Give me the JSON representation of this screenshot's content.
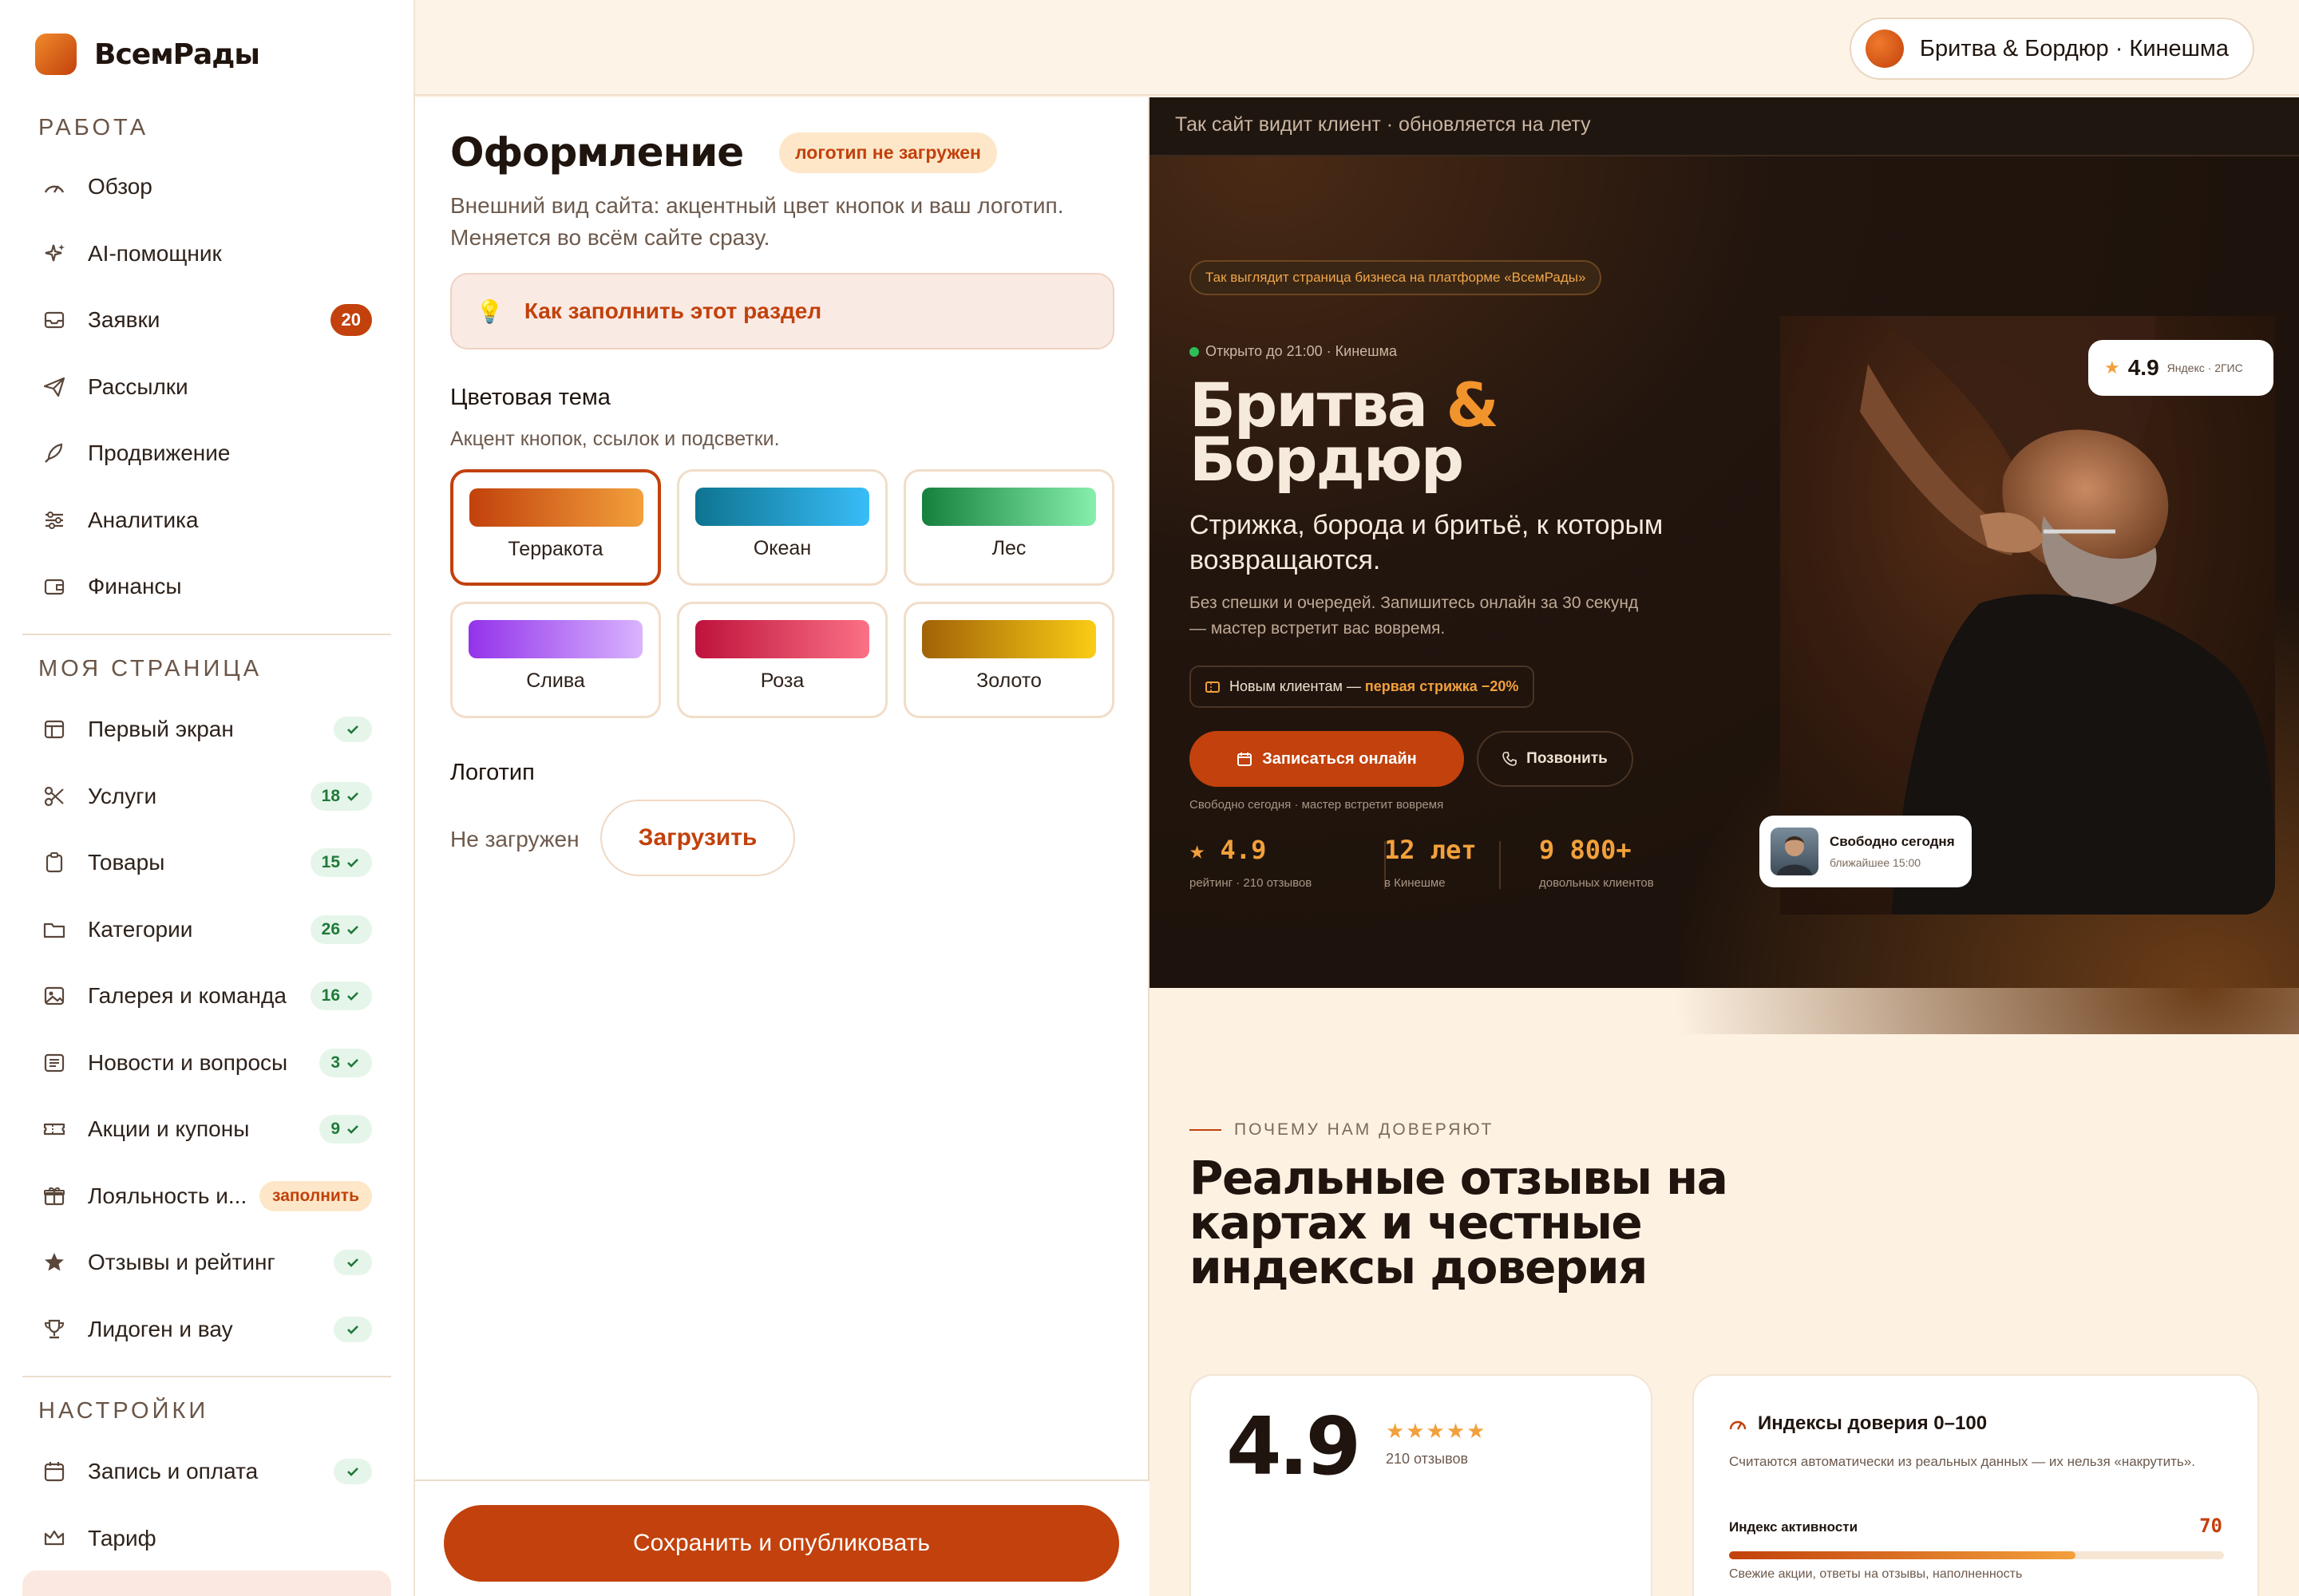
{
  "brand": {
    "name": "ВсемРады"
  },
  "business_pill": {
    "name": "Бритва & Бордюр · Кинешма"
  },
  "sidebar": {
    "section_work": "РАБОТА",
    "section_page": "МОЯ СТРАНИЦА",
    "section_settings": "НАСТРОЙКИ",
    "work_items": [
      {
        "label": "Обзор",
        "icon": "gauge-icon"
      },
      {
        "label": "AI-помощник",
        "icon": "sparkle-icon"
      },
      {
        "label": "Заявки",
        "icon": "inbox-icon",
        "badge": "20"
      },
      {
        "label": "Рассылки",
        "icon": "send-icon"
      },
      {
        "label": "Продвижение",
        "icon": "rocket-icon"
      },
      {
        "label": "Аналитика",
        "icon": "sliders-icon"
      },
      {
        "label": "Финансы",
        "icon": "wallet-icon"
      }
    ],
    "page_items": [
      {
        "label": "Первый экран",
        "icon": "layout-icon",
        "badge": ""
      },
      {
        "label": "Услуги",
        "icon": "scissors-icon",
        "badge": "18"
      },
      {
        "label": "Товары",
        "icon": "clipboard-icon",
        "badge": "15"
      },
      {
        "label": "Категории",
        "icon": "folder-icon",
        "badge": "26"
      },
      {
        "label": "Галерея и команда",
        "icon": "image-icon",
        "badge": "16"
      },
      {
        "label": "Новости и вопросы",
        "icon": "news-icon",
        "badge": "3"
      },
      {
        "label": "Акции и купоны",
        "icon": "ticket-icon",
        "badge": "9"
      },
      {
        "label": "Лояльность и...",
        "icon": "gift-icon",
        "badge_fill": "заполнить"
      },
      {
        "label": "Отзывы и рейтинг",
        "icon": "star-icon",
        "badge": ""
      },
      {
        "label": "Лидоген и вау",
        "icon": "trophy-icon",
        "badge": ""
      }
    ],
    "settings_items": [
      {
        "label": "Запись и оплата",
        "icon": "calendar-icon",
        "badge": ""
      },
      {
        "label": "Тариф",
        "icon": "crown-icon"
      }
    ]
  },
  "editor": {
    "title": "Оформление",
    "status": "логотип не загружен",
    "description": "Внешний вид сайта: акцентный цвет кнопок и ваш логотип. Меняется во всём сайте сразу.",
    "help": "Как заполнить этот раздел",
    "theme_label": "Цветовая тема",
    "theme_hint": "Акцент кнопок, ссылок и подсветки.",
    "themes": [
      {
        "name": "Терракота",
        "from": "#c2410c",
        "to": "#f2a03c",
        "selected": true
      },
      {
        "name": "Океан",
        "from": "#0e7490",
        "to": "#38bdf8",
        "selected": false
      },
      {
        "name": "Лес",
        "from": "#15803d",
        "to": "#86efac",
        "selected": false
      },
      {
        "name": "Слива",
        "from": "#9333ea",
        "to": "#d8b4fe",
        "selected": false
      },
      {
        "name": "Роза",
        "from": "#be123c",
        "to": "#fb7185",
        "selected": false
      },
      {
        "name": "Золото",
        "from": "#a16207",
        "to": "#facc15",
        "selected": false
      }
    ],
    "logo_label": "Логотип",
    "logo_state": "Не загружен",
    "upload": "Загрузить",
    "save": "Сохранить и опубликовать"
  },
  "preview": {
    "bar": "Так сайт видит клиент · обновляется на лету",
    "platform_tag": "Так выглядит страница бизнеса на платформе «ВсемРады»",
    "open_status": "Открыто до 21:00 · Кинешма",
    "title_1": "Бритва",
    "title_amp": "&",
    "title_2": "Бордюр",
    "subtitle": "Стрижка, борода и бритьё, к которым возвращаются.",
    "desc": "Без спешки и очередей. Запишитесь онлайн за 30 секунд — мастер встретит вас вовремя.",
    "promo_a": "Новым клиентам —",
    "promo_b": "первая стрижка −20%",
    "book": "Записаться онлайн",
    "call": "Позвонить",
    "free_note": "Свободно сегодня · мастер встретит вовремя",
    "stats": [
      {
        "value": "★ 4.9",
        "label": "рейтинг · 210 отзывов"
      },
      {
        "value": "12 лет",
        "label": "в Кинешме"
      },
      {
        "value": "9 800+",
        "label": "довольных клиентов"
      }
    ],
    "rating_chip": {
      "value": "4.9",
      "source": "Яндекс · 2ГИС"
    },
    "free_chip": {
      "title": "Свободно сегодня",
      "sub": "ближайшее 15:00"
    },
    "trust_eyebrow": "ПОЧЕМУ НАМ ДОВЕРЯЮТ",
    "trust_title": "Реальные отзывы на картах и честные индексы доверия",
    "card1": {
      "rating": "4.9",
      "stars": "★★★★★",
      "count": "210 отзывов"
    },
    "card2": {
      "title": "Индексы доверия 0–100",
      "desc": "Считаются автоматически из реальных данных — их нельзя «накрутить».",
      "metric": "Индекс активности",
      "value": "70",
      "fill": 0.7,
      "note": "Свежие акции, ответы на отзывы, наполненность"
    }
  }
}
